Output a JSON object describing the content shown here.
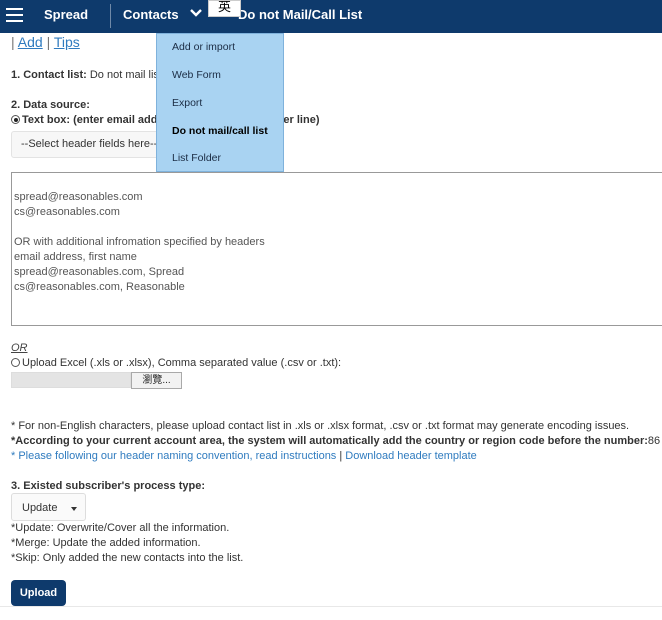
{
  "nav": {
    "brand": "Spread",
    "contacts_label": "Contacts",
    "lang_badge": "英",
    "page_title": "Do not Mail/Call List"
  },
  "dropdown": {
    "items": [
      {
        "label": "Add or import"
      },
      {
        "label": "Web Form"
      },
      {
        "label": "Export"
      },
      {
        "label": "Do not mail/call list"
      },
      {
        "label": "List Folder"
      }
    ]
  },
  "links": {
    "sep": "|",
    "add": "Add",
    "tips": "Tips"
  },
  "contact_list": {
    "label": "1. Contact list:",
    "value": "Do not mail list"
  },
  "data_source": {
    "label": "2. Data source:",
    "textbox_option": "Text box: (enter email address, one contact data per line)",
    "select_placeholder": "--Select header fields here--",
    "textarea_lines": [
      "spread@reasonables.com",
      "cs@reasonables.com",
      "",
      "OR with additional infromation specified by headers",
      "email address, first name",
      "spread@reasonables.com, Spread",
      "cs@reasonables.com, Reasonable"
    ],
    "or_label": "OR",
    "upload_option": "Upload Excel (.xls or .xlsx), Comma separated value (.csv or .txt):",
    "browse_label": "瀏覽..."
  },
  "notes": {
    "non_english": "* For non-English characters, please upload contact list in .xls or .xlsx format, .csv or .txt format may generate encoding issues.",
    "country_code_text": "*According to your current account area, the system will automatically add the country or region code before the number:",
    "country_code_value": "86",
    "naming_text": "* Please following our header naming convention, read instructions",
    "naming_sep": "|",
    "download_template": "Download header template"
  },
  "process_type": {
    "label": "3. Existed subscriber's process type:",
    "selected": "Update",
    "descriptions": [
      "*Update: Overwrite/Cover all the information.",
      "*Merge: Update the added information.",
      "*Skip: Only added the new contacts into the list."
    ]
  },
  "upload_button": "Upload",
  "colors": {
    "navbar": "#0e3a6c",
    "dropdown": "#a9d3f2",
    "link": "#2f7bbf"
  }
}
